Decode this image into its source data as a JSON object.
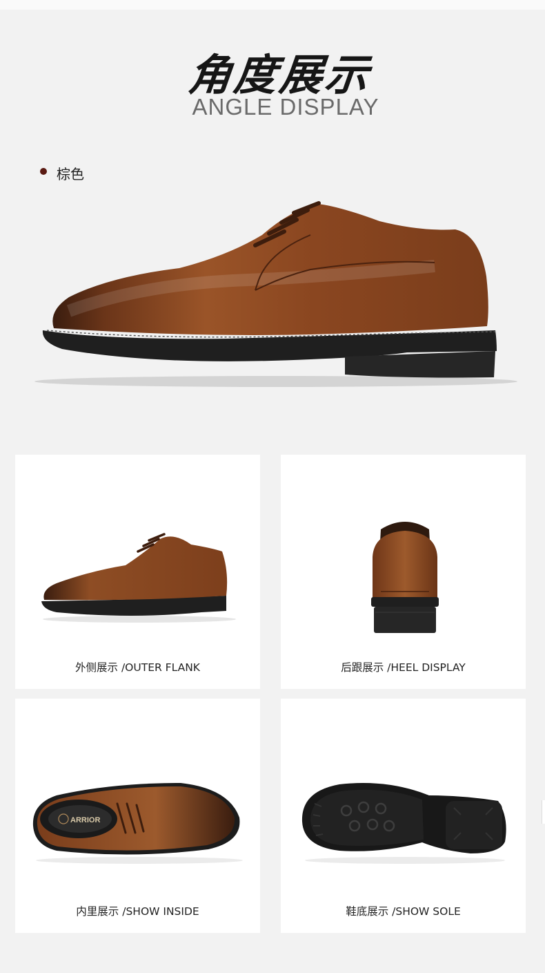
{
  "header": {
    "title_cn": "角度展示",
    "title_en": "ANGLE DISPLAY"
  },
  "color_option": {
    "label": "棕色",
    "dot_color": "#5a1a12"
  },
  "colors": {
    "background": "#f2f2f2",
    "card": "#ffffff",
    "leather": "#8b4a22",
    "sole": "#222222"
  },
  "views": [
    {
      "caption": "外侧展示 /OUTER FLANK",
      "icon": "shoe-side-view"
    },
    {
      "caption": "后跟展示 /HEEL DISPLAY",
      "icon": "shoe-heel-view"
    },
    {
      "caption": "内里展示 /SHOW INSIDE",
      "icon": "shoe-top-view"
    },
    {
      "caption": "鞋底展示 /SHOW SOLE",
      "icon": "shoe-sole-view"
    }
  ],
  "insole_brand": "ARRIOR"
}
